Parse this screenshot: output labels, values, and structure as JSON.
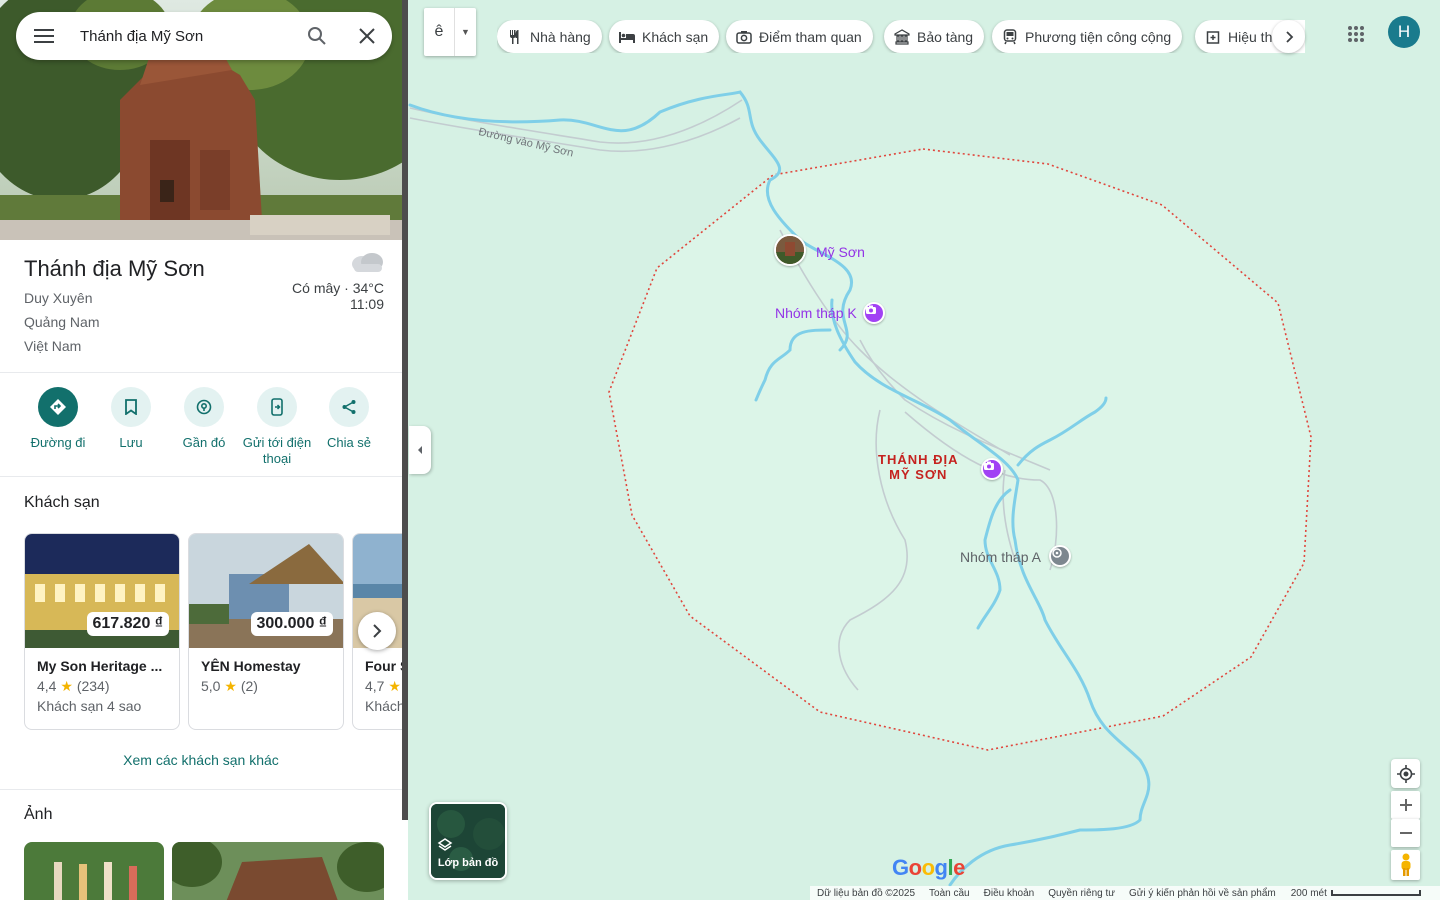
{
  "search": {
    "query": "Thánh địa Mỹ Sơn"
  },
  "place": {
    "title": "Thánh địa Mỹ Sơn",
    "address_lines": [
      "Duy Xuyên",
      "Quảng Nam",
      "Việt Nam"
    ],
    "weather": {
      "condition": "Có mây · 34°C",
      "time": "11:09"
    }
  },
  "actions": [
    {
      "label": "Đường đi",
      "icon": "directions-icon"
    },
    {
      "label": "Lưu",
      "icon": "bookmark-icon"
    },
    {
      "label": "Gần đó",
      "icon": "nearby-icon"
    },
    {
      "label": "Gửi tới điện thoại",
      "icon": "send-to-phone-icon"
    },
    {
      "label": "Chia sẻ",
      "icon": "share-icon"
    }
  ],
  "hotels": {
    "title": "Khách sạn",
    "items": [
      {
        "price": "617.820 ₫",
        "name": "My Son Heritage ...",
        "rating": "4,4",
        "reviews": "(234)",
        "type": "Khách sạn 4 sao"
      },
      {
        "price": "300.000 ₫",
        "name": "YÊN Homestay",
        "rating": "5,0",
        "reviews": "(2)",
        "type": ""
      },
      {
        "price": "",
        "name": "Four S",
        "rating": "4,7",
        "reviews": "",
        "type": "Khách"
      }
    ],
    "more_link": "Xem các khách sạn khác"
  },
  "photos": {
    "title": "Ảnh"
  },
  "ime": {
    "char": "ê"
  },
  "chips": [
    {
      "label": "Nhà hàng",
      "icon": "restaurant-icon"
    },
    {
      "label": "Khách sạn",
      "icon": "hotel-icon"
    },
    {
      "label": "Điểm tham quan",
      "icon": "camera-icon"
    },
    {
      "label": "Bảo tàng",
      "icon": "museum-icon"
    },
    {
      "label": "Phương tiện công cộng",
      "icon": "transit-icon"
    },
    {
      "label": "Hiệu th",
      "icon": "pharmacy-icon"
    }
  ],
  "account": {
    "initial": "H"
  },
  "map": {
    "labels": {
      "road": "Đường vào Mỹ Sơn",
      "my_son": "Mỹ Sơn",
      "group_k": "Nhóm tháp K",
      "sanctuary_line1": "THÁNH ĐỊA",
      "sanctuary_line2": "MỸ SƠN",
      "group_a": "Nhóm tháp A"
    },
    "layers_label": "Lớp bản đồ",
    "logo": "Google",
    "footer": {
      "data": "Dữ liệu bản đồ ©2025",
      "global": "Toàn cầu",
      "terms": "Điều khoản",
      "privacy": "Quyền riêng tư",
      "feedback": "Gửi ý kiến phản hồi về sản phẩm",
      "scale": "200 mét"
    }
  },
  "colors": {
    "accent": "#12706c",
    "map_bg": "#d6f1e4",
    "water": "#7fcfe8",
    "boundary": "#e0463c",
    "poi": "#9334e6"
  }
}
